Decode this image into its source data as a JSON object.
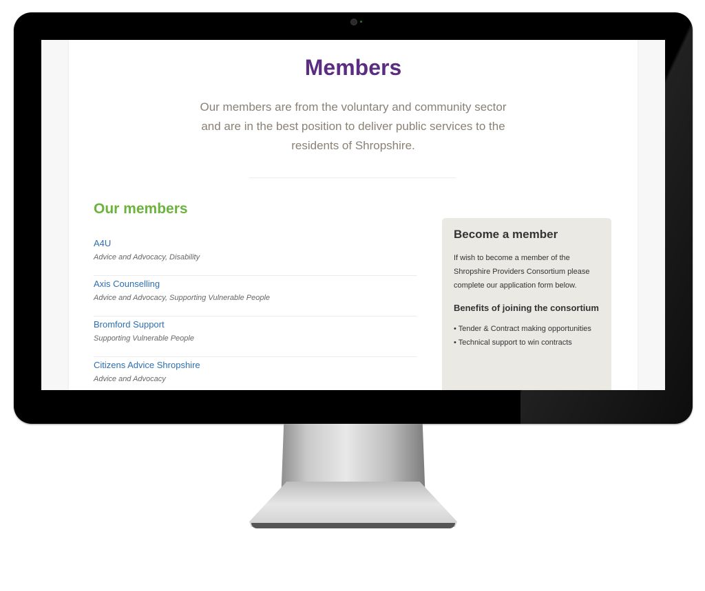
{
  "page": {
    "title": "Members",
    "intro": "Our members are from the voluntary and community sector and are in the best position to deliver public services to the residents of Shropshire."
  },
  "members": {
    "heading": "Our members",
    "items": [
      {
        "name": "A4U",
        "tags": "Advice and Advocacy, Disability"
      },
      {
        "name": "Axis Counselling",
        "tags": "Advice and Advocacy, Supporting Vulnerable People"
      },
      {
        "name": "Bromford Support",
        "tags": "Supporting Vulnerable People"
      },
      {
        "name": "Citizens Advice Shropshire",
        "tags": "Advice and Advocacy"
      }
    ]
  },
  "sidebar": {
    "title": "Become a member",
    "text": "If wish to become a member of the Shropshire Providers Consortium please complete our application form below.",
    "benefits_title": "Benefits of joining the consortium",
    "benefits": [
      "• Tender & Contract making opportunities",
      "• Technical support to win contracts"
    ]
  },
  "colors": {
    "title": "#5b2d82",
    "members_heading": "#6cb33e",
    "link": "#2d6fb0",
    "sidebar_bg": "#ebe9e4"
  }
}
